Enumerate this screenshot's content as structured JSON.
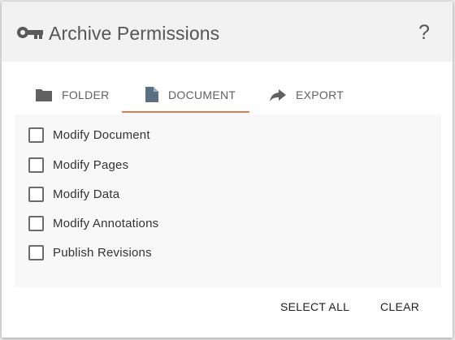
{
  "dialog": {
    "title": "Archive Permissions",
    "help_label": "?",
    "icon": "key-icon"
  },
  "tabs": [
    {
      "label": "FOLDER",
      "icon": "folder-icon",
      "selected": false
    },
    {
      "label": "DOCUMENT",
      "icon": "document-icon",
      "selected": true
    },
    {
      "label": "EXPORT",
      "icon": "share-arrow-icon",
      "selected": false
    }
  ],
  "options": [
    {
      "label": "Modify Document",
      "checked": false
    },
    {
      "label": "Modify Pages",
      "checked": false
    },
    {
      "label": "Modify Data",
      "checked": false
    },
    {
      "label": "Modify Annotations",
      "checked": false
    },
    {
      "label": "Publish Revisions",
      "checked": false
    }
  ],
  "actions": {
    "select_all": "SELECT ALL",
    "clear": "CLEAR"
  },
  "colors": {
    "accent_underline": "#e07b53",
    "header_bg": "#f2f2f2",
    "icon_gray": "#616161",
    "document_icon": "#5a6f80"
  }
}
